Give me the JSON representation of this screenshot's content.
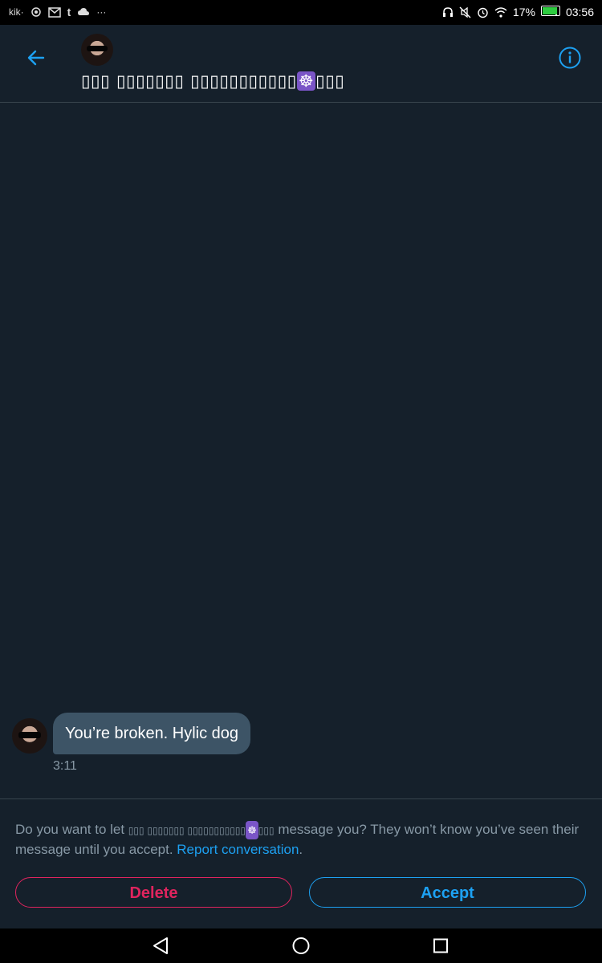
{
  "status_bar": {
    "left_labels": [
      "kik·",
      "t",
      "···"
    ],
    "battery": "17%",
    "time": "03:56",
    "icons": [
      "kik-icon",
      "mention-icon",
      "gmail-icon",
      "tumblr-icon",
      "cloud-icon",
      "headphones-icon",
      "mute-icon",
      "alarm-icon",
      "wifi-icon",
      "battery-icon"
    ]
  },
  "header": {
    "name_prefix": "▯▯▯ ▯▯▯▯▯▯▯ ▯▯▯▯▯▯▯▯▯▯▯",
    "name_emoji": "☸",
    "name_suffix": "▯▯▯",
    "back_icon": "arrow-left-icon",
    "info_icon": "info-icon",
    "accent_color": "#1da1f2"
  },
  "message": {
    "text": "You’re broken. Hylic dog",
    "time": "3:11"
  },
  "request": {
    "text_before": "Do you want to let ",
    "sender_prefix": "▯▯▯ ▯▯▯▯▯▯▯ ▯▯▯▯▯▯▯▯▯▯▯",
    "sender_emoji": "☸",
    "sender_suffix": "▯▯▯",
    "text_after": " message you? They won’t know you’ve seen their message until you accept. ",
    "report_link": "Report conversation",
    "period": "."
  },
  "buttons": {
    "delete_label": "Delete",
    "accept_label": "Accept",
    "delete_color": "#e0245e",
    "accept_color": "#1da1f2"
  },
  "nav": {
    "icons": [
      "back-triangle-icon",
      "home-circle-icon",
      "recents-square-icon"
    ]
  }
}
